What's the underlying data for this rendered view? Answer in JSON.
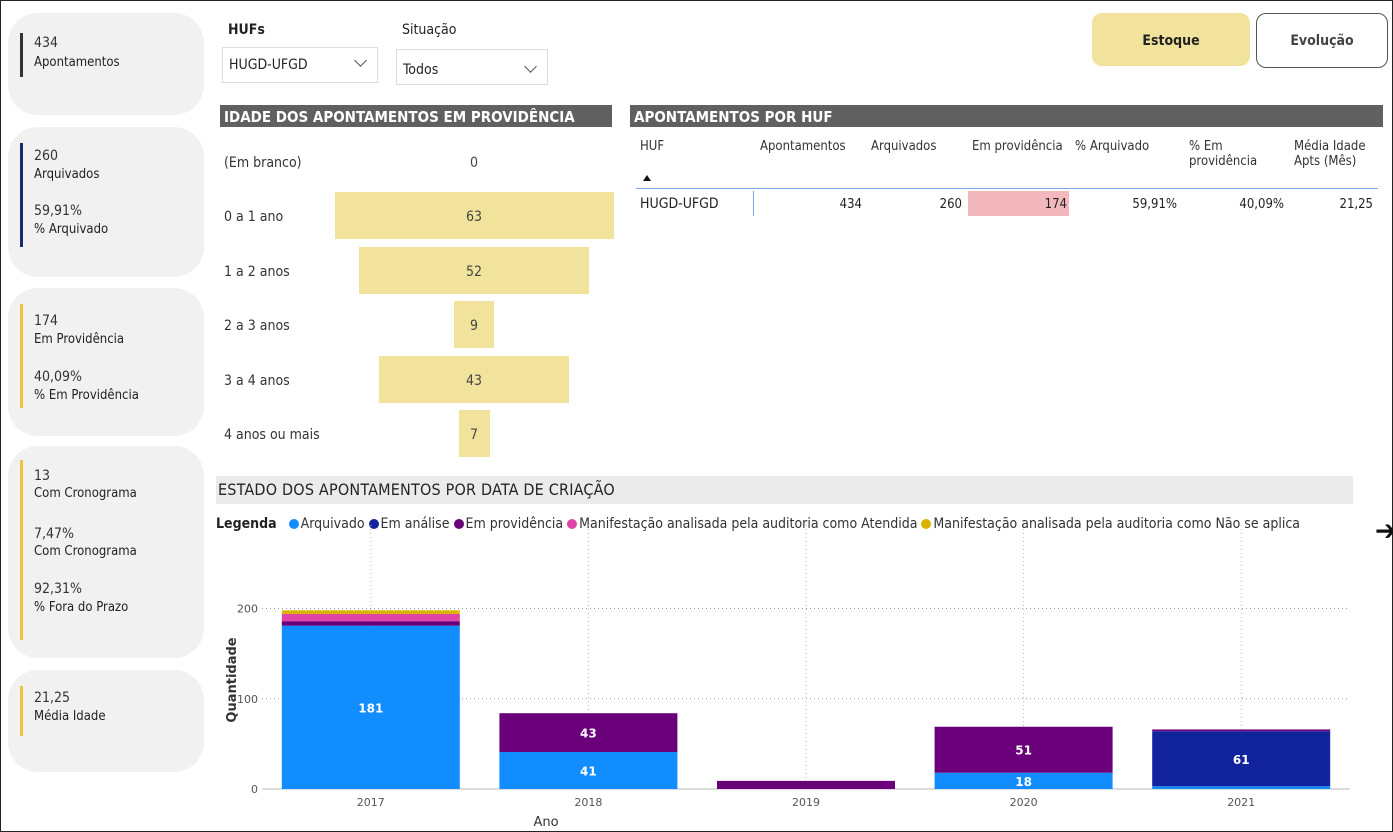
{
  "kpis": [
    {
      "bar_color": "#333333",
      "values": [
        {
          "num": "434",
          "label": "Apontamentos"
        }
      ]
    },
    {
      "bar_color": "#1a2a6c",
      "values": [
        {
          "num": "260",
          "label": "Arquivados"
        },
        {
          "num": "59,91%",
          "label": "% Arquivado"
        }
      ]
    },
    {
      "bar_color": "#e8c547",
      "values": [
        {
          "num": "174",
          "label": "Em Providência"
        },
        {
          "num": "40,09%",
          "label": "% Em Providência"
        }
      ]
    },
    {
      "bar_color": "#e8c547",
      "values": [
        {
          "num": "13",
          "label": "Com Cronograma"
        },
        {
          "num": "7,47%",
          "label": "Com Cronograma"
        },
        {
          "num": "92,31%",
          "label": "% Fora do Prazo"
        }
      ]
    },
    {
      "bar_color": "#e8c547",
      "values": [
        {
          "num": "21,25",
          "label": "Média Idade"
        }
      ]
    }
  ],
  "filters": {
    "hufs": {
      "label": "HUFs",
      "value": "HUGD-UFGD"
    },
    "situacao": {
      "label": "Situação",
      "value": "Todos"
    }
  },
  "buttons": {
    "estoque": "Estoque",
    "evolucao": "Evolução"
  },
  "age_section": {
    "title": "IDADE DOS APONTAMENTOS EM PROVIDÊNCIA",
    "rows": [
      {
        "label": "(Em branco)",
        "value": "0",
        "n": 0
      },
      {
        "label": "0 a 1 ano",
        "value": "63",
        "n": 63
      },
      {
        "label": "1 a 2 anos",
        "value": "52",
        "n": 52
      },
      {
        "label": "2 a 3 anos",
        "value": "9",
        "n": 9
      },
      {
        "label": "3 a 4 anos",
        "value": "43",
        "n": 43
      },
      {
        "label": "4 anos ou mais",
        "value": "7",
        "n": 7
      }
    ]
  },
  "huf_table": {
    "title": "APONTAMENTOS POR HUF",
    "columns": [
      "HUF",
      "Apontamentos",
      "Arquivados",
      "Em providência",
      "% Arquivado",
      "% Em providência",
      "Média Idade Apts (Mês)"
    ],
    "rows": [
      [
        "HUGD-UFGD",
        "434",
        "260",
        "174",
        "59,91%",
        "40,09%",
        "21,25"
      ]
    ],
    "highlight_color": "#f2b8bd"
  },
  "chart_section": {
    "title": "ESTADO DOS APONTAMENTOS POR DATA DE CRIAÇÃO",
    "legend_label": "Legenda",
    "arrow": "➔"
  },
  "chart_data": {
    "type": "bar",
    "stacked": true,
    "xlabel": "Ano",
    "ylabel": "Quantidade",
    "ylim": [
      0,
      215
    ],
    "yticks": [
      0,
      100,
      200
    ],
    "categories": [
      "2017",
      "2018",
      "2019",
      "2020",
      "2021"
    ],
    "series": [
      {
        "name": "Arquivado",
        "color": "#118dff",
        "values": [
          181,
          41,
          0,
          18,
          3
        ],
        "labels": [
          "181",
          "41",
          "",
          "18",
          ""
        ]
      },
      {
        "name": "Em análise",
        "color": "#12239e",
        "values": [
          0,
          0,
          0,
          0,
          61
        ],
        "labels": [
          "",
          "",
          "",
          "",
          "61"
        ]
      },
      {
        "name": "Em providência",
        "color": "#6b007b",
        "values": [
          5,
          43,
          9,
          51,
          2
        ],
        "labels": [
          "",
          "43",
          "",
          "51",
          ""
        ]
      },
      {
        "name": "Manifestação analisada pela auditoria como Atendida",
        "color": "#e044a7",
        "values": [
          8,
          0,
          0,
          0,
          0
        ],
        "labels": [
          "",
          "",
          "",
          "",
          ""
        ]
      },
      {
        "name": "Manifestação analisada pela auditoria como Não se aplica",
        "color": "#d9b300",
        "values": [
          4,
          0,
          0,
          0,
          0
        ],
        "labels": [
          "",
          "",
          "",
          "",
          ""
        ]
      }
    ],
    "gridlines": true
  }
}
